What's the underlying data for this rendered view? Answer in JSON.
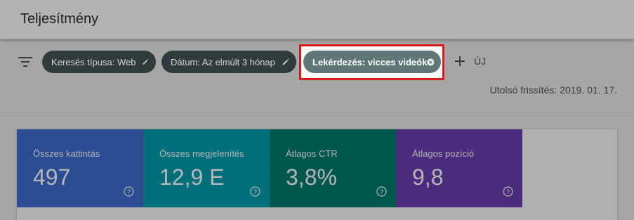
{
  "header": {
    "title": "Teljesítmény"
  },
  "filters": {
    "chips": [
      {
        "label": "Keresés típusa: Web"
      },
      {
        "label": "Dátum: Az elmúlt 3 hónap"
      },
      {
        "label": "Lekérdezés: vicces videók"
      }
    ],
    "new_label": "ÚJ"
  },
  "last_update": "Utolsó frissítés: 2019. 01. 17.",
  "metrics": [
    {
      "label": "Összes kattintás",
      "value": "497",
      "color": "#2b4b92"
    },
    {
      "label": "Összes megjelenítés",
      "value": "12,9 E",
      "color": "#006f7a"
    },
    {
      "label": "Átlagos CTR",
      "value": "3,8%",
      "color": "#00574e"
    },
    {
      "label": "Átlagos pozíció",
      "value": "9,8",
      "color": "#4a2b7c"
    }
  ],
  "colors": {
    "highlight": "#d71a1a",
    "active_chip": "#5f7777"
  }
}
